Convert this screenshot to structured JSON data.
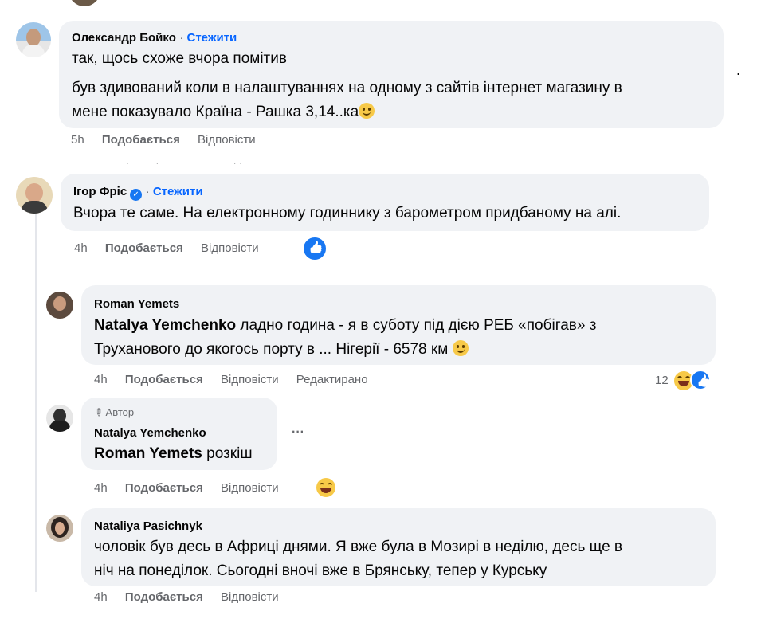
{
  "colors": {
    "link": "#0866ff",
    "meta": "#65676b",
    "bubble": "#f0f2f5",
    "like": "#1877f2"
  },
  "comments": [
    {
      "author": "Олександр Бойко",
      "follow": "Стежити",
      "lines": [
        "так, щось схоже вчора помітив",
        "був здивований коли в налаштуваннях на одному з сайтів інтернет магазину в",
        "мене показувало Країна - Рашка 3,14..ка"
      ],
      "time": "5h",
      "like": "Подобається",
      "reply": "Відповісти"
    },
    {
      "author": "Ігор Фріс",
      "follow": "Стежити",
      "text": "Вчора те саме. На електронному годиннику з барометром придбаному на алі.",
      "time": "4h",
      "like": "Подобається",
      "reply": "Відповісти",
      "reaction": "like-icon"
    },
    {
      "author": "Roman Yemets",
      "mention": "Natalya Yemchenko",
      "text1": " ладно година - я в суботу під дією РЕБ «побігав» з",
      "text2": "Труханового до якогось порту в ... Нігерії - 6578 км",
      "time": "4h",
      "like": "Подобається",
      "reply": "Відповісти",
      "edited": "Редактирано",
      "reaction_count": "12"
    },
    {
      "badge": "Автор",
      "author": "Natalya Yemchenko",
      "mention": "Roman Yemets",
      "text": " розкіш",
      "more": "···",
      "time": "4h",
      "like": "Подобається",
      "reply": "Відповісти"
    },
    {
      "author": "Nataliya Pasichnyk",
      "line1": "чоловік був десь в Африці днями. Я вже була в Мозирі в неділю, десь ще в",
      "line2": "ніч на понеділок. Сьогодні вночі вже в Брянську, тепер у Курську",
      "time": "4h",
      "like": "Подобається",
      "reply": "Відповісти"
    }
  ],
  "side_dot": "."
}
